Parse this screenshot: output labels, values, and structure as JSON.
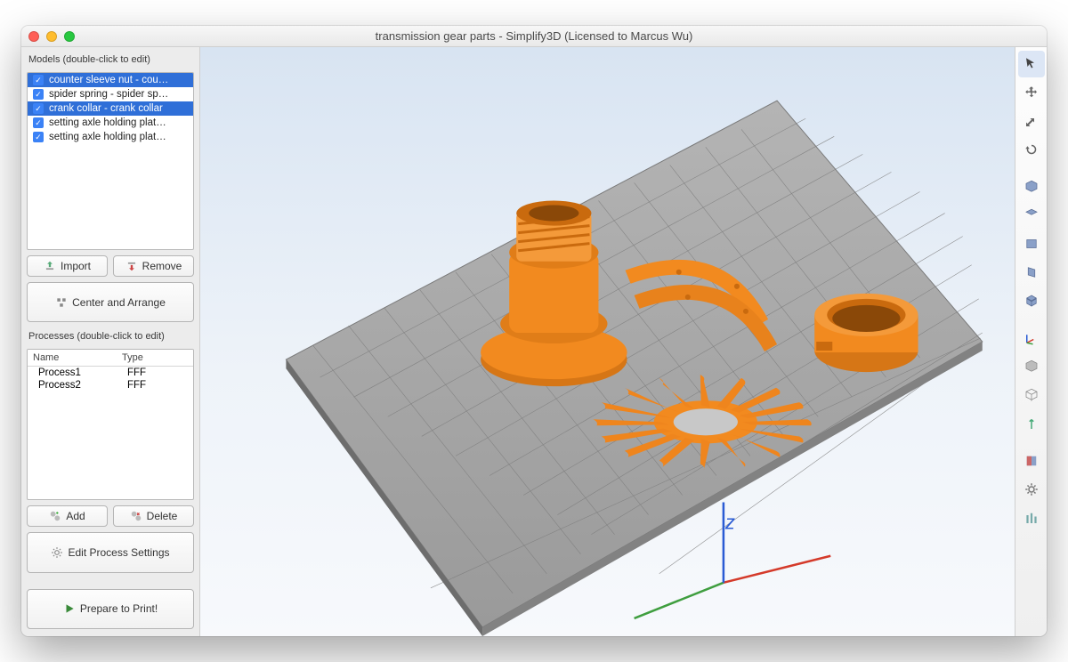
{
  "window": {
    "title": "transmission gear parts - Simplify3D (Licensed to Marcus Wu)"
  },
  "sidebar": {
    "models_label": "Models (double-click to edit)",
    "models": [
      {
        "label": "counter sleeve nut - cou…",
        "selected": true,
        "checked": true
      },
      {
        "label": "spider spring - spider sp…",
        "selected": false,
        "checked": true
      },
      {
        "label": "crank collar - crank collar",
        "selected": true,
        "checked": true
      },
      {
        "label": "setting axle holding plat…",
        "selected": false,
        "checked": true
      },
      {
        "label": "setting axle holding plat…",
        "selected": false,
        "checked": true
      }
    ],
    "buttons": {
      "import": "Import",
      "remove": "Remove",
      "center": "Center and Arrange"
    },
    "processes_label": "Processes (double-click to edit)",
    "process_headers": {
      "name": "Name",
      "type": "Type"
    },
    "processes": [
      {
        "name": "Process1",
        "type": "FFF"
      },
      {
        "name": "Process2",
        "type": "FFF"
      }
    ],
    "process_buttons": {
      "add": "Add",
      "delete": "Delete",
      "edit": "Edit Process Settings",
      "prepare": "Prepare to Print!"
    }
  },
  "colors": {
    "model": "#f28a1f",
    "model_shadow": "#c96a0e",
    "bed_line": "#8d8d8d",
    "axis_x": "#d43a2a",
    "axis_y": "#3f9e3f",
    "axis_z": "#2a5bd4"
  },
  "toolbar_items": [
    "pointer",
    "move",
    "scale",
    "rotate",
    "",
    "view-default",
    "view-top",
    "view-front",
    "view-side",
    "view-iso",
    "",
    "axis-triad",
    "shaded",
    "wireframe",
    "normals",
    "",
    "cross-section",
    "settings",
    "supports"
  ]
}
